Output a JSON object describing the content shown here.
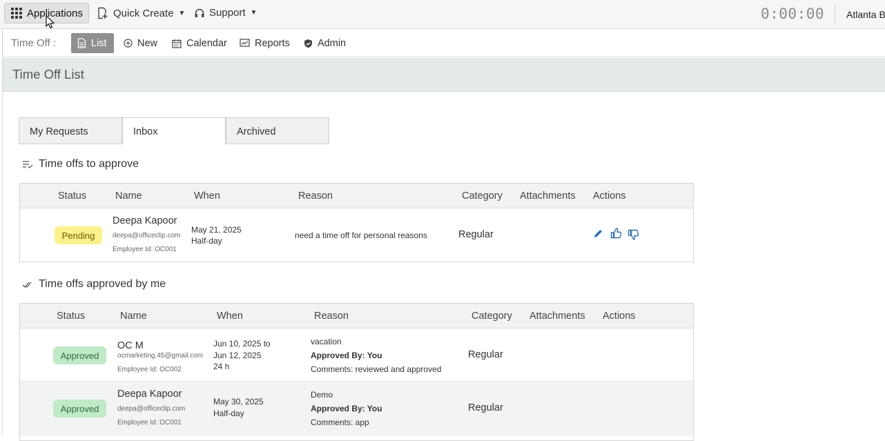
{
  "topbar": {
    "applications_label": "Applications",
    "quick_create_label": "Quick Create",
    "support_label": "Support",
    "timer": "0:00:00",
    "company": "Atlanta B"
  },
  "subnav": {
    "title": "Time Off :",
    "items": [
      {
        "label": "List",
        "icon": "document-icon",
        "active": true
      },
      {
        "label": "New",
        "icon": "plus-circle-icon"
      },
      {
        "label": "Calendar",
        "icon": "calendar-icon"
      },
      {
        "label": "Reports",
        "icon": "chart-icon"
      },
      {
        "label": "Admin",
        "icon": "shield-icon"
      }
    ]
  },
  "page": {
    "title": "Time Off List"
  },
  "tabs": [
    {
      "label": "My Requests"
    },
    {
      "label": "Inbox",
      "active": true
    },
    {
      "label": "Archived"
    }
  ],
  "to_approve": {
    "title": "Time offs to approve",
    "columns": [
      "Status",
      "Name",
      "When",
      "Reason",
      "Category",
      "Attachments",
      "Actions"
    ],
    "rows": [
      {
        "status": "Pending",
        "name": "Deepa Kapoor",
        "email": "deepa@officeclip.com",
        "employee_id": "Employee Id: OC001",
        "when_line1": "May 21, 2025",
        "when_line2": "Half-day",
        "reason": "need a time off for personal reasons",
        "category": "Regular"
      }
    ]
  },
  "approved_by_me": {
    "title": "Time offs approved by me",
    "columns": [
      "Status",
      "Name",
      "When",
      "Reason",
      "Category",
      "Attachments",
      "Actions"
    ],
    "rows": [
      {
        "status": "Approved",
        "name": "OC M",
        "email": "ocmarketing.45@gmail.com",
        "employee_id": "Employee Id: OC002",
        "when_line1": "Jun 10, 2025 to",
        "when_line2": "Jun 12, 2025",
        "when_line3": "24 h",
        "reason": "vacation",
        "approved_by": "Approved By: You",
        "comments": "Comments: reviewed and approved",
        "category": "Regular"
      },
      {
        "status": "Approved",
        "name": "Deepa Kapoor",
        "email": "deepa@officeclip.com",
        "employee_id": "Employee Id: OC001",
        "when_line1": "May 30, 2025",
        "when_line2": "Half-day",
        "reason": "Demo",
        "approved_by": "Approved By: You",
        "comments": "Comments: app",
        "category": "Regular"
      }
    ]
  },
  "colors": {
    "pending_bg": "#fbf28a",
    "approved_bg": "#bfeac6",
    "action_blue": "#2a6fb8",
    "header_band": "#e3eae7"
  }
}
